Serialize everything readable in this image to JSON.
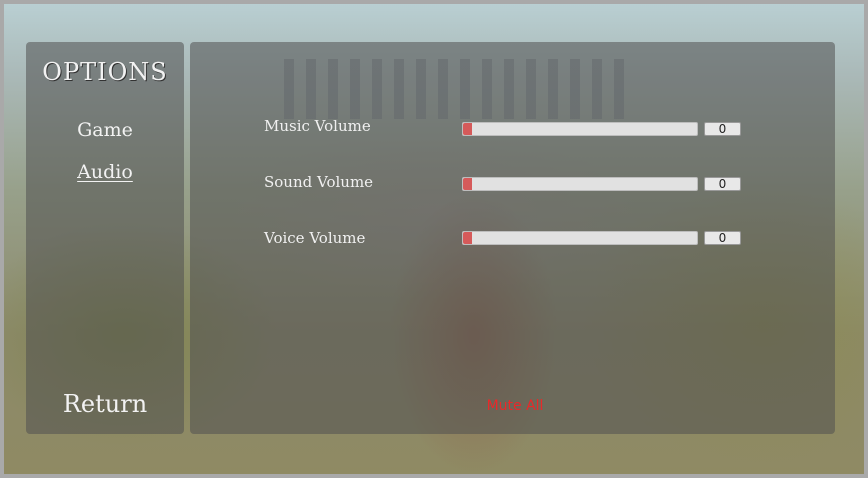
{
  "menu": {
    "title": "OPTIONS",
    "items": [
      {
        "label": "Game"
      },
      {
        "label": "Audio"
      }
    ],
    "return_label": "Return"
  },
  "audio": {
    "rows": [
      {
        "label": "Music Volume",
        "value": "0",
        "level": 0
      },
      {
        "label": "Sound Volume",
        "value": "0",
        "level": 0
      },
      {
        "label": "Voice Volume",
        "value": "0",
        "level": 0
      }
    ],
    "mute_label": "Mute All"
  },
  "colors": {
    "accent": "#d55a5a",
    "mute_text": "#e8292a",
    "panel": "rgba(80,80,80,0.55)"
  }
}
